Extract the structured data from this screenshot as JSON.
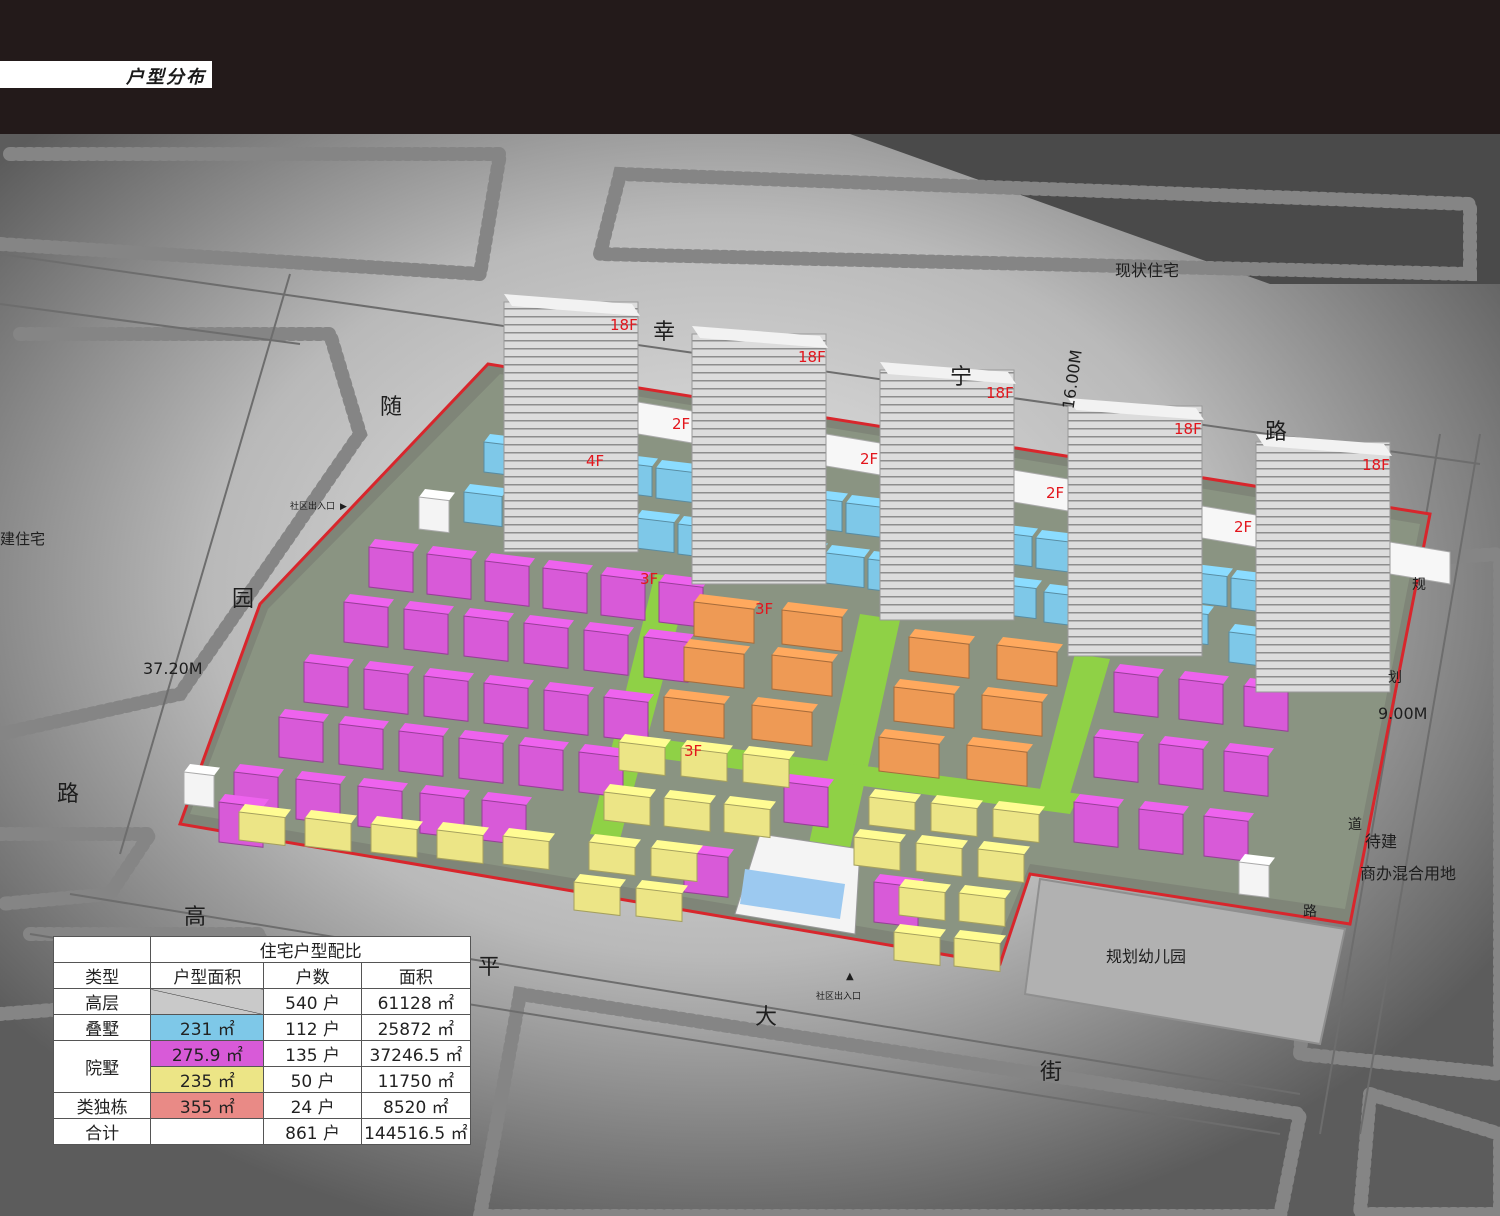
{
  "page_title": "户型分布",
  "map_labels": {
    "xing_road": [
      "幸",
      "宁",
      "路"
    ],
    "xing_road_width": "16.00M",
    "suiyuan_road": [
      "随",
      "园",
      "路"
    ],
    "suiyuan_road_width": "37.20M",
    "gaoping_street": [
      "高",
      "平",
      "大",
      "街"
    ],
    "plan_road": [
      "规",
      "划",
      "道",
      "路"
    ],
    "plan_road_width": "9.00M",
    "existing_residential": "现状住宅",
    "planned_residential": "建住宅",
    "mixed_use": [
      "待建",
      "商办混合用地"
    ],
    "kindergarten": "规划幼儿园",
    "community_entrance_north": "社区出入口",
    "community_entrance_south": "社区出入口"
  },
  "floor_labels": {
    "tower": "18F",
    "podium": "2F",
    "stacked_villa": "4F",
    "courtyard": "3F"
  },
  "colors": {
    "stacked_villa": "#7ec8e8",
    "courtyard_villa_a": "#d85ad8",
    "courtyard_villa_b": "#ece586",
    "semi_detached": "#ee9a55",
    "high_rise": "#d9d9d9",
    "green": "#8fd146",
    "boundary": "#d8262c"
  },
  "table": {
    "title": "住宅户型配比",
    "headers": [
      "类型",
      "户型面积",
      "户数",
      "面积"
    ],
    "rows": [
      {
        "type": "高层",
        "area": "",
        "units": "540 户",
        "total": "61128 ㎡"
      },
      {
        "type": "叠墅",
        "area": "231 ㎡",
        "units": "112 户",
        "total": "25872 ㎡"
      },
      {
        "type": "院墅",
        "area": "275.9 ㎡",
        "units": "135 户",
        "total": "37246.5 ㎡"
      },
      {
        "type": "",
        "area": "235 ㎡",
        "units": "50 户",
        "total": "11750 ㎡"
      },
      {
        "type": "类独栋",
        "area": "355 ㎡",
        "units": "24 户",
        "total": "8520 ㎡"
      },
      {
        "type": "合计",
        "area": "",
        "units": "861 户",
        "total": "144516.5 ㎡"
      }
    ]
  }
}
